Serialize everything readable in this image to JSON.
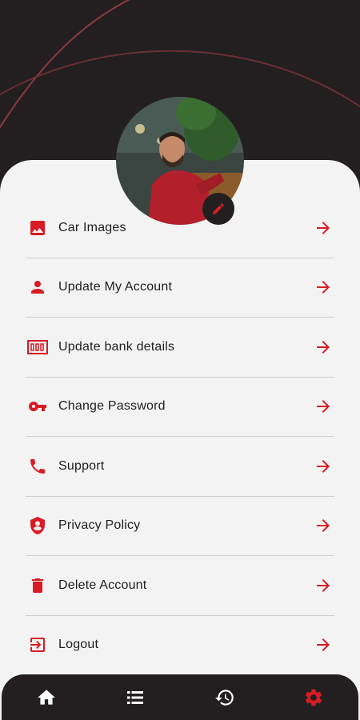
{
  "colors": {
    "accent": "#d81b24",
    "dark": "#231f20",
    "sheet": "#f3f3f3"
  },
  "profile": {
    "avatar_icon": "profile-photo",
    "edit_icon": "pencil-icon"
  },
  "menu": {
    "items": [
      {
        "label": "Car Images",
        "icon": "image-icon"
      },
      {
        "label": "Update My Account",
        "icon": "person-icon"
      },
      {
        "label": "Update bank details",
        "icon": "bank-card-icon"
      },
      {
        "label": "Change Password",
        "icon": "key-icon"
      },
      {
        "label": "Support",
        "icon": "phone-icon"
      },
      {
        "label": "Privacy Policy",
        "icon": "shield-icon"
      },
      {
        "label": "Delete Account",
        "icon": "trash-icon"
      },
      {
        "label": "Logout",
        "icon": "logout-icon"
      }
    ]
  },
  "bottom_nav": {
    "items": [
      {
        "icon": "home-icon",
        "active": false
      },
      {
        "icon": "list-icon",
        "active": false
      },
      {
        "icon": "history-icon",
        "active": false
      },
      {
        "icon": "settings-icon",
        "active": true
      }
    ]
  }
}
